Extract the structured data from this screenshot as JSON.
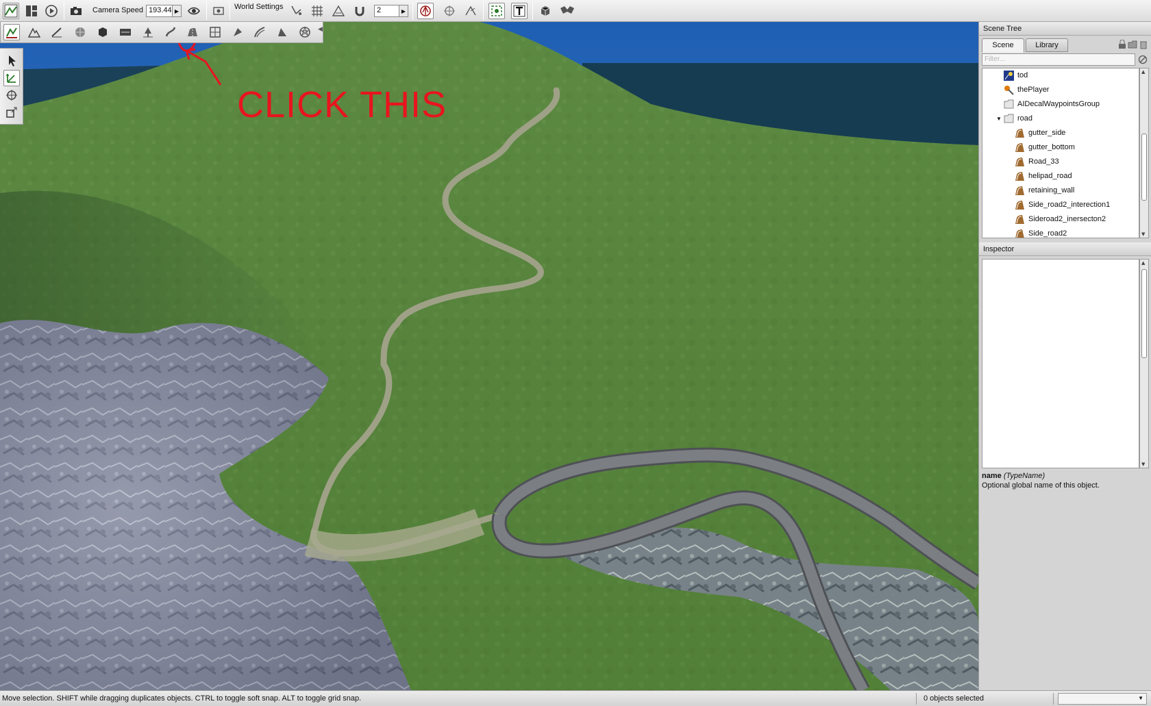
{
  "toolbar": {
    "camera_speed_label": "Camera Speed",
    "camera_speed_value": "193.44",
    "world_settings_label": "World Settings",
    "snap_value": "2"
  },
  "annotation": {
    "text": "CLICK THIS",
    "color": "#e8141e"
  },
  "scene_tree": {
    "title": "Scene Tree",
    "tabs": [
      "Scene",
      "Library"
    ],
    "active_tab": "Scene",
    "filter_placeholder": "Filter...",
    "items": [
      {
        "label": "tod",
        "icon": "time-of-day-icon",
        "depth": 1
      },
      {
        "label": "thePlayer",
        "icon": "player-icon",
        "depth": 1
      },
      {
        "label": "AIDecalWaypointsGroup",
        "icon": "folder-icon",
        "depth": 1
      },
      {
        "label": "road",
        "icon": "folder-icon",
        "depth": 1,
        "expanded": true
      },
      {
        "label": "gutter_side",
        "icon": "road-icon",
        "depth": 2
      },
      {
        "label": "gutter_bottom",
        "icon": "road-icon",
        "depth": 2
      },
      {
        "label": "Road_33",
        "icon": "road-icon",
        "depth": 2
      },
      {
        "label": "helipad_road",
        "icon": "road-icon",
        "depth": 2
      },
      {
        "label": "retaining_wall",
        "icon": "road-icon",
        "depth": 2
      },
      {
        "label": "Side_road2_interection1",
        "icon": "road-icon",
        "depth": 2
      },
      {
        "label": "Sideroad2_inersecton2",
        "icon": "road-icon",
        "depth": 2
      },
      {
        "label": "Side_road2",
        "icon": "road-icon",
        "depth": 2
      }
    ]
  },
  "inspector": {
    "title": "Inspector",
    "help_field": "name",
    "help_type": "(TypeName)",
    "help_text": "Optional global name of this object."
  },
  "status": {
    "message": "Move selection.  SHIFT while dragging duplicates objects.  CTRL to toggle soft snap.  ALT to toggle grid snap.",
    "selection_count": "0 objects selected"
  },
  "colors": {
    "grass": "#5f8a3e",
    "sky": "#2b6ab8",
    "sea": "#153a4e",
    "road": "#6f7276",
    "path": "#9b9d82"
  }
}
